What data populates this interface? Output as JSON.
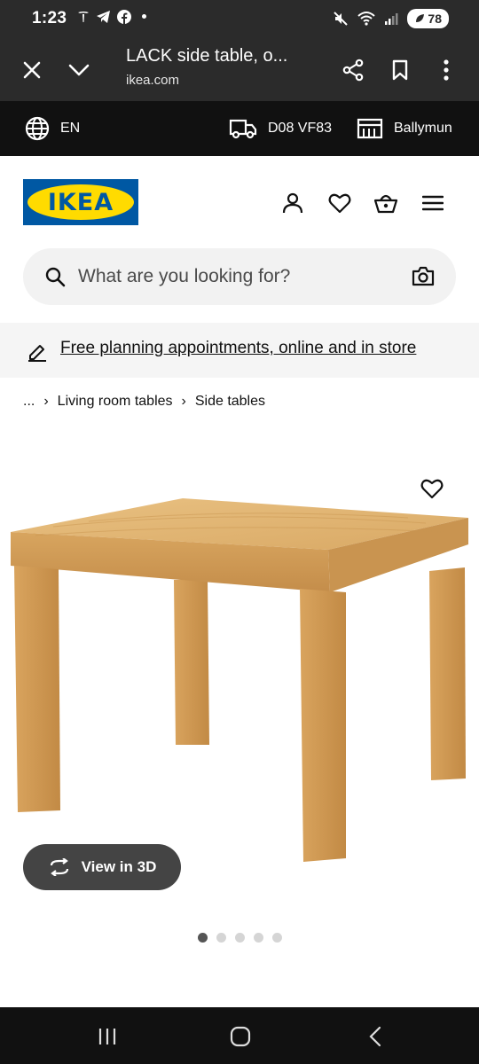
{
  "status_bar": {
    "time": "1:23",
    "battery": "78"
  },
  "browser": {
    "title": "LACK side table, o...",
    "url": "ikea.com"
  },
  "location_bar": {
    "language": "EN",
    "postcode": "D08 VF83",
    "store": "Ballymun"
  },
  "header": {
    "logo_text": "IKEA"
  },
  "search": {
    "placeholder": "What are you looking for?"
  },
  "promo": {
    "text": "Free planning appointments, online and in store"
  },
  "breadcrumb": {
    "ellipsis": "...",
    "items": [
      "Living room tables",
      "Side tables"
    ]
  },
  "product": {
    "view_3d_label": "View in 3D",
    "image_count": 5,
    "active_image": 1
  },
  "colors": {
    "ikea_blue": "#0058a3",
    "ikea_yellow": "#ffdb00",
    "dark_bar": "#2b2b2b"
  }
}
